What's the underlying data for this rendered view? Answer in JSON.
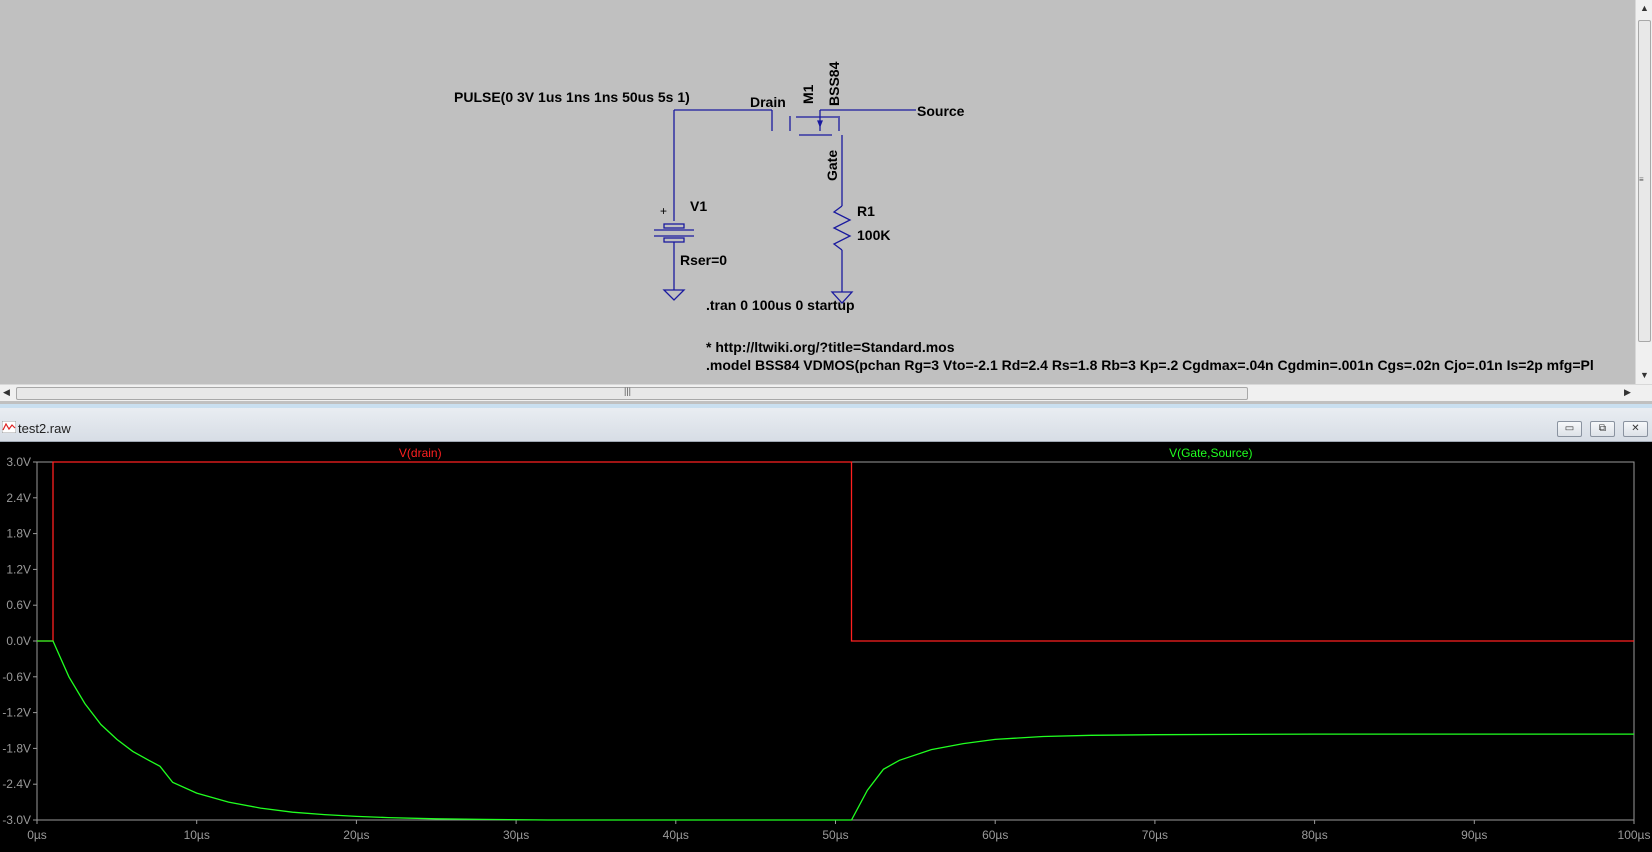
{
  "schematic": {
    "source_spec": "PULSE(0 3V 1us 1ns 1ns 50us 5s 1)",
    "net_drain": "Drain",
    "net_source": "Source",
    "net_gate": "Gate",
    "mosfet_name": "M1",
    "mosfet_model": "BSS84",
    "v1_name": "V1",
    "v1_rser": "Rser=0",
    "r1_name": "R1",
    "r1_value": "100K",
    "plus_sign": "+",
    "directive_tran": ".tran 0 100us 0 startup",
    "comment_url": "* http://ltwiki.org/?title=Standard.mos",
    "model_line": ".model BSS84 VDMOS(pchan Rg=3 Vto=-2.1 Rd=2.4 Rs=1.8 Rb=3 Kp=.2 Cgdmax=.04n Cgdmin=.001n Cgs=.02n Cjo=.01n Is=2p mfg=Pl",
    "wire_color": "#1a1a9e"
  },
  "scrollbars": {
    "h_grip": "|||",
    "v_grip": "≡"
  },
  "wave_window": {
    "title": "test2.raw",
    "btn_minimize": "▭",
    "btn_restore": "⧉",
    "btn_close": "✕"
  },
  "chart_data": {
    "type": "line",
    "xlabel": "",
    "ylabel": "",
    "xlim": [
      0,
      100
    ],
    "ylim": [
      -3.0,
      3.0
    ],
    "x_ticks": [
      "0µs",
      "10µs",
      "20µs",
      "30µs",
      "40µs",
      "50µs",
      "60µs",
      "70µs",
      "80µs",
      "90µs",
      "100µs"
    ],
    "y_ticks": [
      "3.0V",
      "2.4V",
      "1.8V",
      "1.2V",
      "0.6V",
      "0.0V",
      "-0.6V",
      "-1.2V",
      "-1.8V",
      "-2.4V",
      "-3.0V"
    ],
    "series": [
      {
        "name": "V(drain)",
        "color": "#ff2020",
        "x": [
          0,
          1,
          1.001,
          51,
          51.001,
          100
        ],
        "y": [
          0,
          0,
          3.0,
          3.0,
          0,
          0
        ]
      },
      {
        "name": "V(Gate,Source)",
        "color": "#20ff20",
        "x": [
          0,
          1,
          2,
          3,
          4,
          5,
          6,
          7,
          7.7,
          8.5,
          10,
          12,
          14,
          16,
          18,
          20,
          22,
          25,
          28,
          32,
          36,
          40,
          45,
          51,
          52,
          53,
          54,
          56,
          58,
          60,
          63,
          66,
          70,
          80,
          90,
          100
        ],
        "y": [
          0,
          0,
          -0.6,
          -1.05,
          -1.4,
          -1.65,
          -1.85,
          -2.0,
          -2.1,
          -2.37,
          -2.55,
          -2.7,
          -2.8,
          -2.87,
          -2.91,
          -2.94,
          -2.96,
          -2.98,
          -2.99,
          -3.0,
          -3.0,
          -3.0,
          -3.0,
          -3.0,
          -2.5,
          -2.15,
          -2.0,
          -1.82,
          -1.72,
          -1.65,
          -1.6,
          -1.58,
          -1.57,
          -1.56,
          -1.56,
          -1.56
        ]
      }
    ]
  }
}
